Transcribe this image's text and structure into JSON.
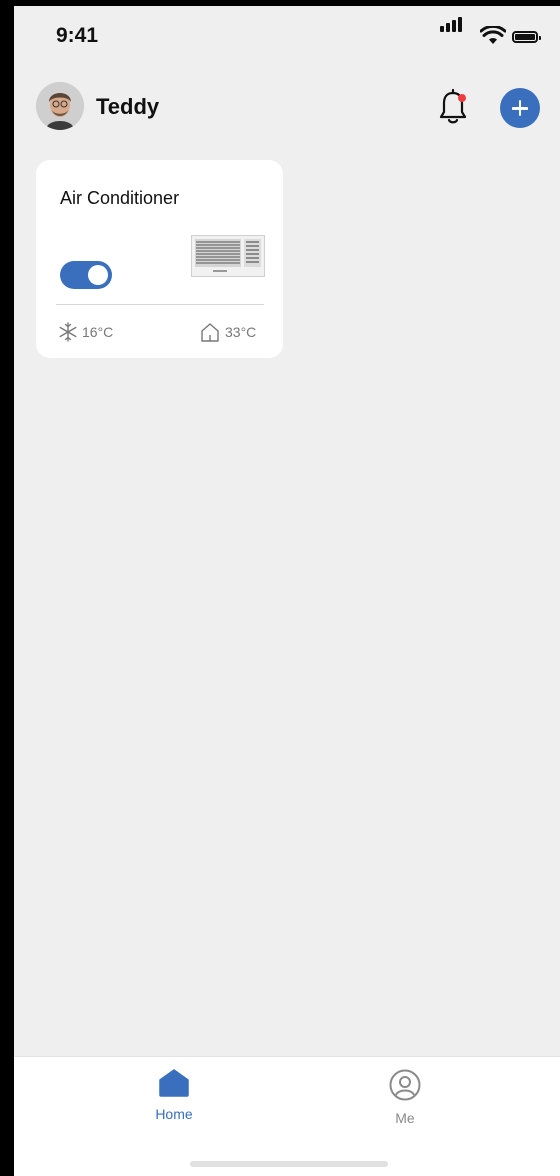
{
  "status_bar": {
    "time": "9:41",
    "icons": [
      "cellular-signal-icon",
      "wifi-icon",
      "battery-icon"
    ]
  },
  "header": {
    "user_name": "Teddy",
    "avatar": "avatar",
    "notification_icon": "bell-icon",
    "notification_badge": true,
    "add_icon": "plus-icon"
  },
  "devices": [
    {
      "name": "Air Conditioner",
      "power_on": true,
      "set_temperature": "16°C",
      "room_temperature": "33°C",
      "mode_icon": "snowflake-icon",
      "room_icon": "house-icon"
    }
  ],
  "tab_bar": {
    "tabs": [
      {
        "label": "Home",
        "icon": "home-icon",
        "active": true
      },
      {
        "label": "Me",
        "icon": "profile-icon",
        "active": false
      }
    ]
  },
  "colors": {
    "accent": "#3a6fbd",
    "background": "#efefef",
    "card": "#ffffff",
    "notification_dot": "#ef3d3d",
    "inactive": "#8a8a8a"
  }
}
